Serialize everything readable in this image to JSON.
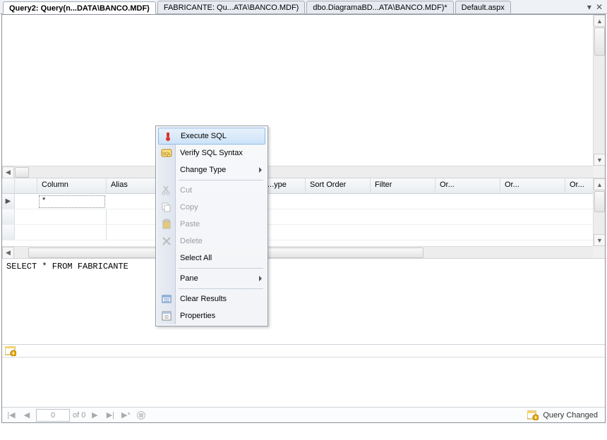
{
  "tabs": [
    {
      "label": "Query2: Query(n...DATA\\BANCO.MDF)",
      "active": true
    },
    {
      "label": "FABRICANTE: Qu...ATA\\BANCO.MDF)",
      "active": false
    },
    {
      "label": "dbo.DiagramaBD...ATA\\BANCO.MDF)*",
      "active": false
    },
    {
      "label": "Default.aspx",
      "active": false
    }
  ],
  "grid": {
    "headers": [
      "",
      "Column",
      "Alias",
      "",
      "",
      "...ype",
      "Sort Order",
      "Filter",
      "Or...",
      "Or...",
      "Or..."
    ],
    "row0_column": "*"
  },
  "sql": "SELECT   *   FROM   FABRICANTE",
  "navigator": {
    "position": "0",
    "of_label": "of 0"
  },
  "status_right": "Query Changed",
  "context_menu": {
    "items": [
      {
        "label": "Execute SQL",
        "highlight": true,
        "icon": "execute"
      },
      {
        "label": "Verify SQL Syntax",
        "icon": "verify"
      },
      {
        "label": "Change Type",
        "submenu": true
      }
    ],
    "items2": [
      {
        "label": "Cut",
        "disabled": true,
        "icon": "cut"
      },
      {
        "label": "Copy",
        "disabled": true,
        "icon": "copy"
      },
      {
        "label": "Paste",
        "disabled": true,
        "icon": "paste"
      },
      {
        "label": "Delete",
        "disabled": true,
        "icon": "delete"
      },
      {
        "label": "Select All"
      }
    ],
    "items3": [
      {
        "label": "Pane",
        "submenu": true
      }
    ],
    "items4": [
      {
        "label": "Clear Results",
        "icon": "clear"
      },
      {
        "label": "Properties",
        "icon": "properties"
      }
    ]
  }
}
